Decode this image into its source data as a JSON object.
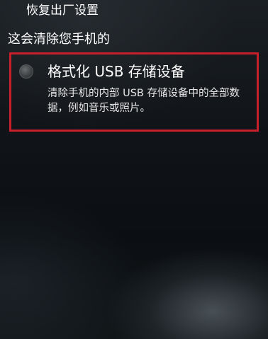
{
  "header": {
    "title": "恢复出厂设置"
  },
  "content": {
    "subheader": "这会清除您手机的",
    "option": {
      "title": "格式化 USB 存储设备",
      "description": "清除手机的内部 USB 存储设备中的全部数据，例如音乐或照片。",
      "checked": false
    }
  },
  "colors": {
    "highlight_border": "#c8202a",
    "text": "#ffffff"
  }
}
